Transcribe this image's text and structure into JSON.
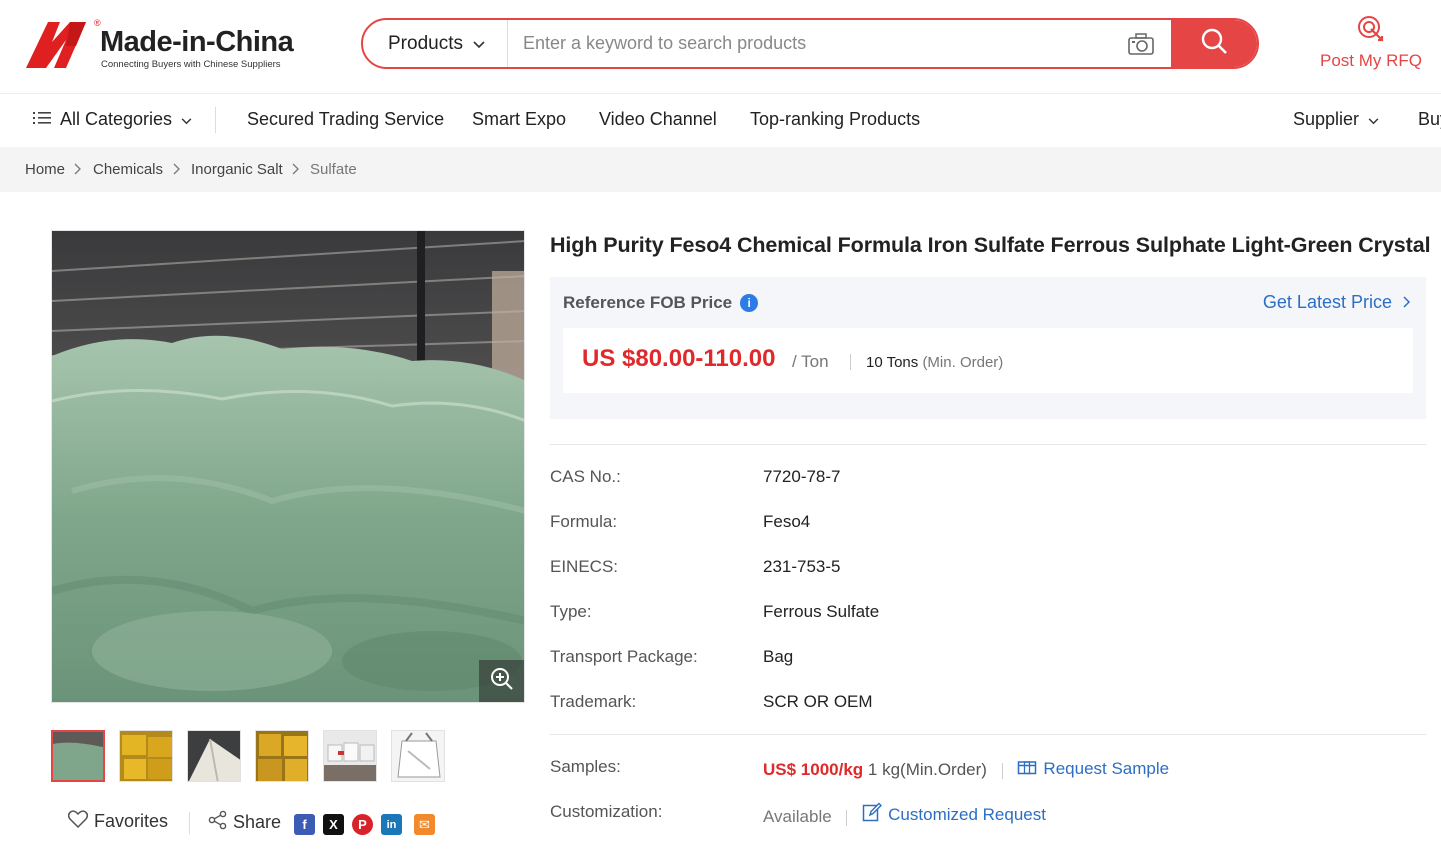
{
  "brand": {
    "name": "Made-in-China",
    "tagline": "Connecting Buyers with Chinese Suppliers",
    "registered": "®"
  },
  "search": {
    "category": "Products",
    "placeholder": "Enter a keyword to search products"
  },
  "rfq": {
    "label": "Post My RFQ"
  },
  "nav": {
    "all_categories": "All Categories",
    "items": [
      "Secured Trading Service",
      "Smart Expo",
      "Video Channel",
      "Top-ranking Products"
    ],
    "supplier": "Supplier",
    "buyer": "Buy"
  },
  "breadcrumb": [
    "Home",
    "Chemicals",
    "Inorganic Salt",
    "Sulfate"
  ],
  "product": {
    "title_pre": "High Purity Feso4 Chemical Formula ",
    "title_highlight": "Iron Sulfate Ferrous Sulphate",
    "title_post": " Light-Green Crystal",
    "ref_price_label": "Reference FOB Price",
    "info_glyph": "i",
    "get_latest": "Get Latest Price",
    "price": "US $80.00-110.00",
    "unit": "/ Ton",
    "moq_value": "10 Tons",
    "moq_label": "(Min. Order)"
  },
  "attributes": [
    {
      "key": "CAS No.:",
      "value": "7720-78-7"
    },
    {
      "key": "Formula:",
      "value": "Feso4"
    },
    {
      "key": "EINECS:",
      "value": "231-753-5"
    },
    {
      "key": "Type:",
      "value": "Ferrous Sulfate"
    },
    {
      "key": "Transport Package:",
      "value": "Bag"
    },
    {
      "key": "Trademark:",
      "value": "SCR OR OEM"
    }
  ],
  "samples": {
    "label": "Samples:",
    "price": "US$ 1000/kg",
    "moq": "1 kg(Min.Order)",
    "action": "Request Sample"
  },
  "customization": {
    "label": "Customization:",
    "value": "Available",
    "action": "Customized Request"
  },
  "actions": {
    "favorites": "Favorites",
    "share": "Share"
  },
  "social": [
    {
      "name": "facebook",
      "glyph": "f",
      "color": "#3b5bb5"
    },
    {
      "name": "x",
      "glyph": "X",
      "color": "#111111"
    },
    {
      "name": "pinterest",
      "glyph": "P",
      "color": "#d8232a"
    },
    {
      "name": "linkedin",
      "glyph": "in",
      "color": "#1a78b8"
    },
    {
      "name": "email",
      "glyph": "✉",
      "color": "#f08a2c"
    }
  ],
  "colors": {
    "accent": "#e64545",
    "price": "#e0292b",
    "link": "#2d6ec4",
    "highlight": "#fbf10a",
    "crystal": "#7fa68a"
  }
}
